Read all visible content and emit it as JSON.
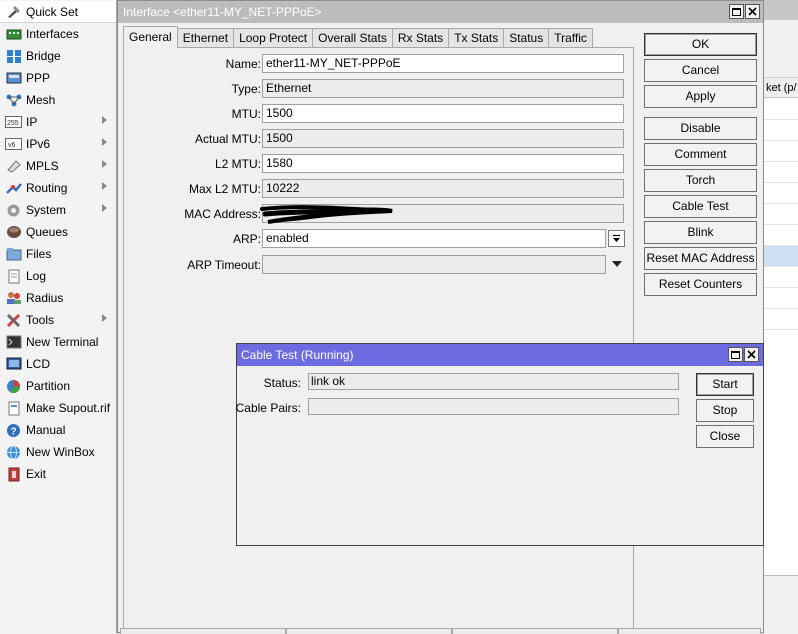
{
  "sidebar": {
    "items": [
      {
        "label": "Quick Set",
        "icon": "quick-set-icon",
        "submenu": false
      },
      {
        "label": "Interfaces",
        "icon": "interfaces-icon",
        "submenu": false
      },
      {
        "label": "Bridge",
        "icon": "bridge-icon",
        "submenu": false
      },
      {
        "label": "PPP",
        "icon": "ppp-icon",
        "submenu": false
      },
      {
        "label": "Mesh",
        "icon": "mesh-icon",
        "submenu": false
      },
      {
        "label": "IP",
        "icon": "ip-icon",
        "submenu": true
      },
      {
        "label": "IPv6",
        "icon": "ipv6-icon",
        "submenu": true
      },
      {
        "label": "MPLS",
        "icon": "mpls-icon",
        "submenu": true
      },
      {
        "label": "Routing",
        "icon": "routing-icon",
        "submenu": true
      },
      {
        "label": "System",
        "icon": "system-icon",
        "submenu": true
      },
      {
        "label": "Queues",
        "icon": "queues-icon",
        "submenu": false
      },
      {
        "label": "Files",
        "icon": "files-icon",
        "submenu": false
      },
      {
        "label": "Log",
        "icon": "log-icon",
        "submenu": false
      },
      {
        "label": "Radius",
        "icon": "radius-icon",
        "submenu": false
      },
      {
        "label": "Tools",
        "icon": "tools-icon",
        "submenu": true
      },
      {
        "label": "New Terminal",
        "icon": "terminal-icon",
        "submenu": false
      },
      {
        "label": "LCD",
        "icon": "lcd-icon",
        "submenu": false
      },
      {
        "label": "Partition",
        "icon": "partition-icon",
        "submenu": false
      },
      {
        "label": "Make Supout.rif",
        "icon": "supout-icon",
        "submenu": false
      },
      {
        "label": "Manual",
        "icon": "manual-icon",
        "submenu": false
      },
      {
        "label": "New WinBox",
        "icon": "winbox-icon",
        "submenu": false
      },
      {
        "label": "Exit",
        "icon": "exit-icon",
        "submenu": false
      }
    ]
  },
  "background_window": {
    "header_fragment": "ket (p/"
  },
  "interface_window": {
    "title": "Interface <ether11-MY_NET-PPPoE>",
    "tabs": [
      "General",
      "Ethernet",
      "Loop Protect",
      "Overall Stats",
      "Rx Stats",
      "Tx Stats",
      "Status",
      "Traffic"
    ],
    "active_tab": "General",
    "fields": {
      "name": {
        "label": "Name:",
        "value": "ether11-MY_NET-PPPoE"
      },
      "type": {
        "label": "Type:",
        "value": "Ethernet"
      },
      "mtu": {
        "label": "MTU:",
        "value": "1500"
      },
      "actual_mtu": {
        "label": "Actual MTU:",
        "value": "1500"
      },
      "l2_mtu": {
        "label": "L2 MTU:",
        "value": "1580"
      },
      "max_l2_mtu": {
        "label": "Max L2 MTU:",
        "value": "10222"
      },
      "mac_address": {
        "label": "MAC Address:",
        "value": ""
      },
      "arp": {
        "label": "ARP:",
        "value": "enabled"
      },
      "arp_timeout": {
        "label": "ARP Timeout:",
        "value": ""
      }
    },
    "buttons": {
      "ok": "OK",
      "cancel": "Cancel",
      "apply": "Apply",
      "disable": "Disable",
      "comment": "Comment",
      "torch": "Torch",
      "cable_test": "Cable Test",
      "blink": "Blink",
      "reset_mac": "Reset MAC Address",
      "reset_counters": "Reset Counters"
    }
  },
  "cable_test_dialog": {
    "title": "Cable Test (Running)",
    "status_label": "Status:",
    "status_value": "link ok",
    "cable_pairs_label": "Cable Pairs:",
    "cable_pairs_value": "",
    "buttons": {
      "start": "Start",
      "stop": "Stop",
      "close": "Close"
    }
  },
  "colors": {
    "dialog_title_bg": "#6c6ce0",
    "main_title_bg": "#bcbcbc",
    "selection_highlight": "#cfe0f5"
  }
}
